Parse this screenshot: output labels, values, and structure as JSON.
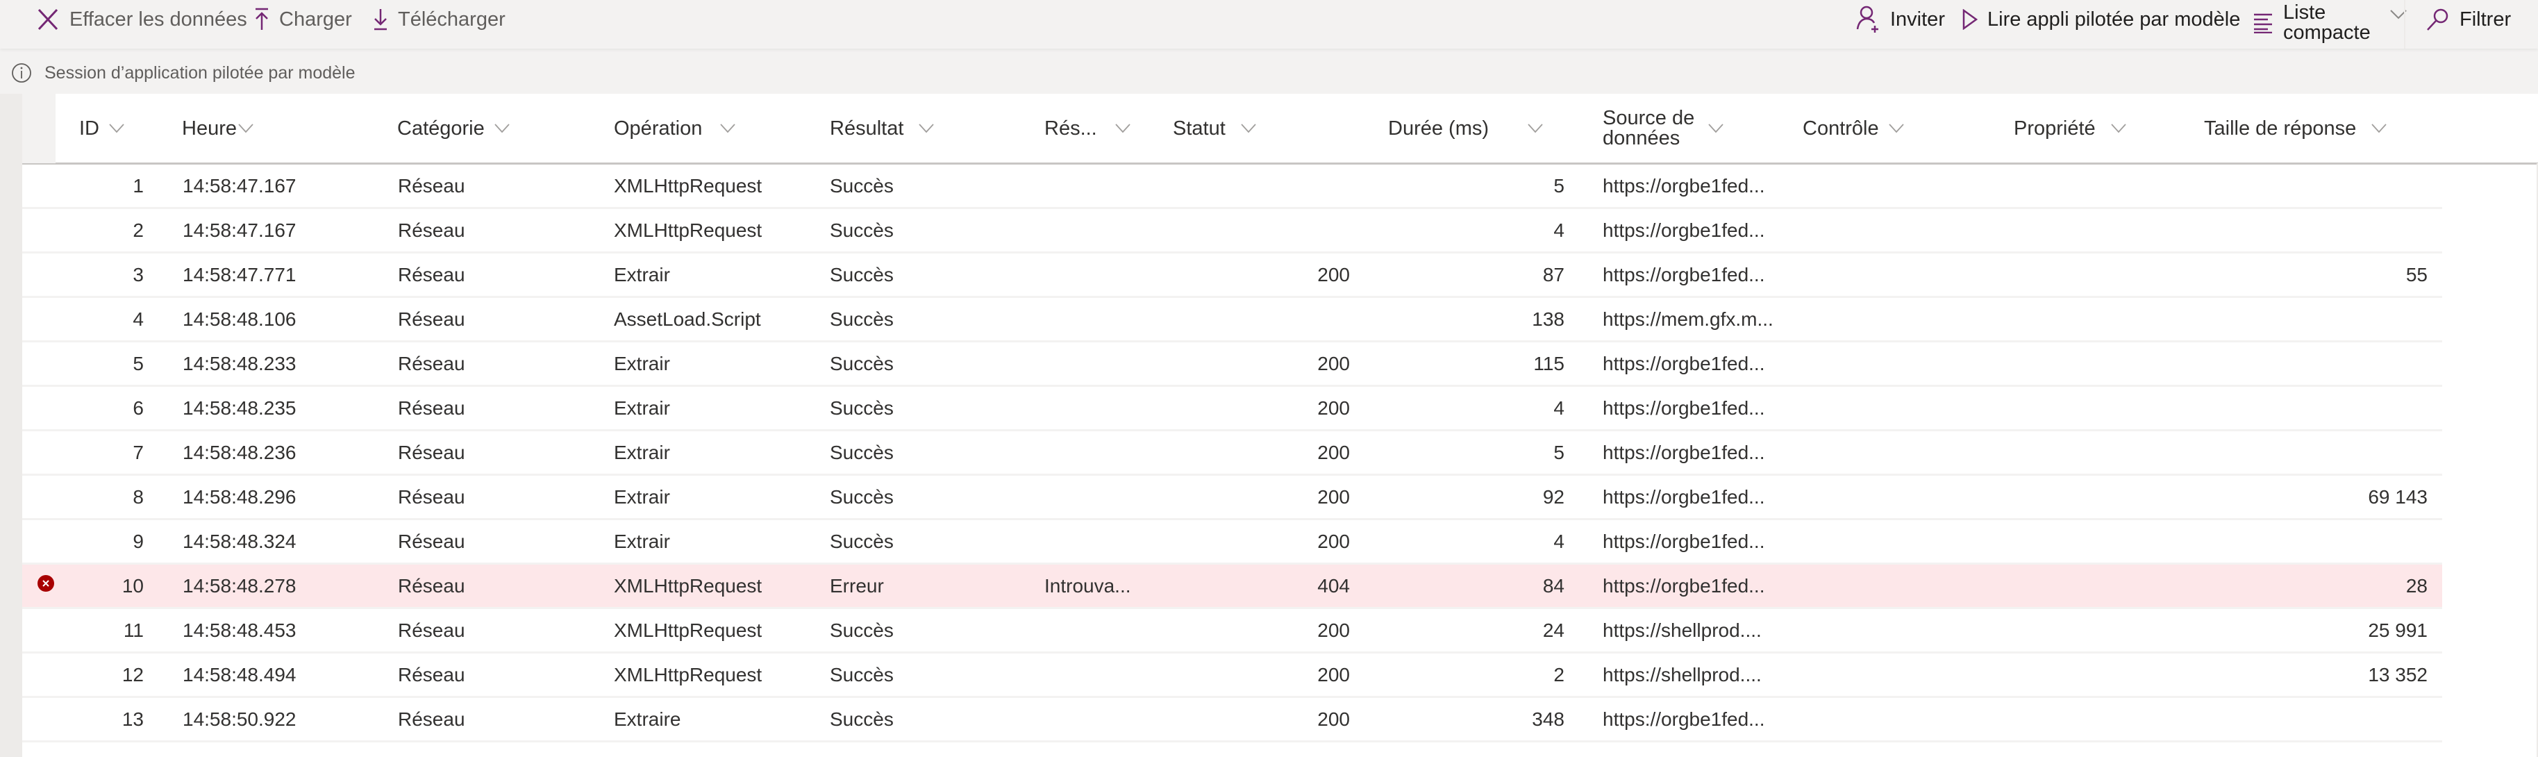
{
  "toolbar": {
    "clear_label": "Effacer les données",
    "upload_label": "Charger",
    "download_label": "Télécharger",
    "invite_label": "Inviter",
    "play_label": "Lire appli pilotée par modèle",
    "view_label_line1": "Liste",
    "view_label_line2": "compacte",
    "filter_label": "Filtrer"
  },
  "info": {
    "text": "Session d’application pilotée par modèle"
  },
  "colors": {
    "accent": "#742774",
    "error_row": "#fde7e9",
    "error_icon": "#a80000"
  },
  "columns": [
    {
      "key": "id",
      "label": "ID"
    },
    {
      "key": "time",
      "label": "Heure"
    },
    {
      "key": "category",
      "label": "Catégorie"
    },
    {
      "key": "operation",
      "label": "Opération"
    },
    {
      "key": "result",
      "label": "Résultat"
    },
    {
      "key": "result_info",
      "label": "Rés..."
    },
    {
      "key": "status",
      "label": "Statut"
    },
    {
      "key": "duration",
      "label": "Durée (ms)"
    },
    {
      "key": "source_line1",
      "label": "Source de"
    },
    {
      "key": "source_line2",
      "label": "données"
    },
    {
      "key": "control",
      "label": "Contrôle"
    },
    {
      "key": "property",
      "label": "Propriété"
    },
    {
      "key": "response_size",
      "label": "Taille de réponse"
    }
  ],
  "rows": [
    {
      "id": "1",
      "time": "14:58:47.167",
      "category": "Réseau",
      "operation": "XMLHttpRequest",
      "result": "Succès",
      "result_info": "",
      "status": "",
      "duration": "5",
      "source": "https://orgbe1fed...",
      "control": "",
      "property": "",
      "response_size": "",
      "error": false
    },
    {
      "id": "2",
      "time": "14:58:47.167",
      "category": "Réseau",
      "operation": "XMLHttpRequest",
      "result": "Succès",
      "result_info": "",
      "status": "",
      "duration": "4",
      "source": "https://orgbe1fed...",
      "control": "",
      "property": "",
      "response_size": "",
      "error": false
    },
    {
      "id": "3",
      "time": "14:58:47.771",
      "category": "Réseau",
      "operation": "Extrair",
      "result": "Succès",
      "result_info": "",
      "status": "200",
      "duration": "87",
      "source": "https://orgbe1fed...",
      "control": "",
      "property": "",
      "response_size": "55",
      "error": false
    },
    {
      "id": "4",
      "time": "14:58:48.106",
      "category": "Réseau",
      "operation": "AssetLoad.Script",
      "result": "Succès",
      "result_info": "",
      "status": "",
      "duration": "138",
      "source": "https://mem.gfx.m...",
      "control": "",
      "property": "",
      "response_size": "",
      "error": false
    },
    {
      "id": "5",
      "time": "14:58:48.233",
      "category": "Réseau",
      "operation": "Extrair",
      "result": "Succès",
      "result_info": "",
      "status": "200",
      "duration": "115",
      "source": "https://orgbe1fed...",
      "control": "",
      "property": "",
      "response_size": "",
      "error": false
    },
    {
      "id": "6",
      "time": "14:58:48.235",
      "category": "Réseau",
      "operation": "Extrair",
      "result": "Succès",
      "result_info": "",
      "status": "200",
      "duration": "4",
      "source": "https://orgbe1fed...",
      "control": "",
      "property": "",
      "response_size": "",
      "error": false
    },
    {
      "id": "7",
      "time": "14:58:48.236",
      "category": "Réseau",
      "operation": "Extrair",
      "result": "Succès",
      "result_info": "",
      "status": "200",
      "duration": "5",
      "source": "https://orgbe1fed...",
      "control": "",
      "property": "",
      "response_size": "",
      "error": false
    },
    {
      "id": "8",
      "time": "14:58:48.296",
      "category": "Réseau",
      "operation": "Extrair",
      "result": "Succès",
      "result_info": "",
      "status": "200",
      "duration": "92",
      "source": "https://orgbe1fed...",
      "control": "",
      "property": "",
      "response_size": "69 143",
      "error": false
    },
    {
      "id": "9",
      "time": "14:58:48.324",
      "category": "Réseau",
      "operation": "Extrair",
      "result": "Succès",
      "result_info": "",
      "status": "200",
      "duration": "4",
      "source": "https://orgbe1fed...",
      "control": "",
      "property": "",
      "response_size": "",
      "error": false
    },
    {
      "id": "10",
      "time": "14:58:48.278",
      "category": "Réseau",
      "operation": "XMLHttpRequest",
      "result": "Erreur",
      "result_info": "Introuva...",
      "status": "404",
      "duration": "84",
      "source": "https://orgbe1fed...",
      "control": "",
      "property": "",
      "response_size": "28",
      "error": true
    },
    {
      "id": "11",
      "time": "14:58:48.453",
      "category": "Réseau",
      "operation": "XMLHttpRequest",
      "result": "Succès",
      "result_info": "",
      "status": "200",
      "duration": "24",
      "source": "https://shellprod....",
      "control": "",
      "property": "",
      "response_size": "25 991",
      "error": false
    },
    {
      "id": "12",
      "time": "14:58:48.494",
      "category": "Réseau",
      "operation": "XMLHttpRequest",
      "result": "Succès",
      "result_info": "",
      "status": "200",
      "duration": "2",
      "source": "https://shellprod....",
      "control": "",
      "property": "",
      "response_size": "13 352",
      "error": false
    },
    {
      "id": "13",
      "time": "14:58:50.922",
      "category": "Réseau",
      "operation": "Extraire",
      "result": "Succès",
      "result_info": "",
      "status": "200",
      "duration": "348",
      "source": "https://orgbe1fed...",
      "control": "",
      "property": "",
      "response_size": "",
      "error": false
    }
  ]
}
